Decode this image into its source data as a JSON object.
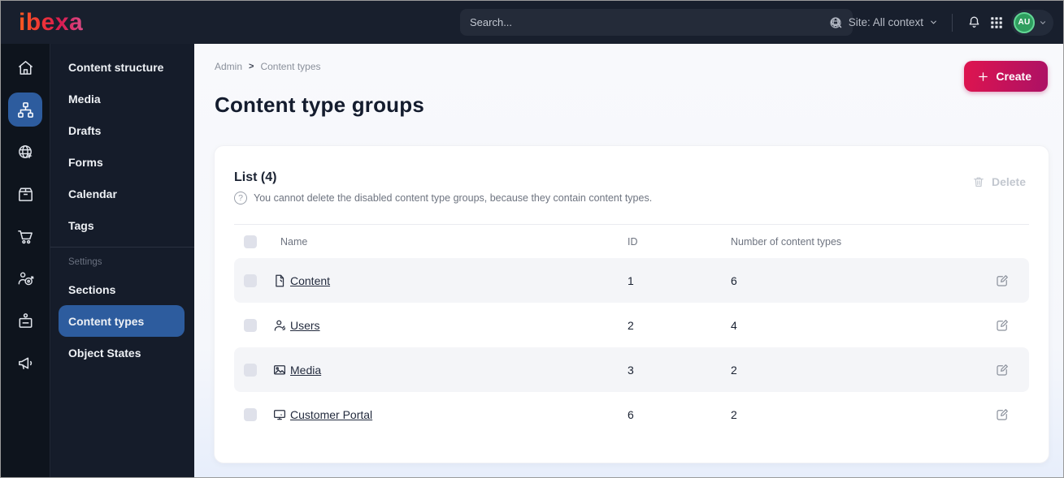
{
  "topbar": {
    "logo_text": "ibexa",
    "search_placeholder": "Search...",
    "site_context_label": "Site: All context",
    "avatar_initials": "AU"
  },
  "sidebar": {
    "rail_icons": [
      "home",
      "content-structure",
      "site",
      "product-catalog",
      "commerce",
      "customer",
      "corporate",
      "marketing"
    ],
    "items_top": [
      "Content structure",
      "Media",
      "Drafts",
      "Forms",
      "Calendar",
      "Tags"
    ],
    "section_label": "Settings",
    "items_settings": [
      "Sections",
      "Content types",
      "Object States"
    ],
    "active_item": "Content types"
  },
  "breadcrumb": {
    "items": [
      "Admin",
      "Content types"
    ],
    "separator": ">"
  },
  "page": {
    "title": "Content type groups",
    "create_button_label": "Create"
  },
  "list_panel": {
    "title": "List (4)",
    "info_text": "You cannot delete the disabled content type groups, because they contain content types.",
    "delete_button_label": "Delete",
    "table": {
      "columns": [
        "Name",
        "ID",
        "Number of content types"
      ],
      "rows": [
        {
          "icon": "file-icon",
          "name": "Content",
          "id": "1",
          "content_types_count": "6"
        },
        {
          "icon": "user-icon",
          "name": "Users",
          "id": "2",
          "content_types_count": "4"
        },
        {
          "icon": "image-icon",
          "name": "Media",
          "id": "3",
          "content_types_count": "2"
        },
        {
          "icon": "monitor-icon",
          "name": "Customer Portal",
          "id": "6",
          "content_types_count": "2"
        }
      ]
    }
  },
  "colors": {
    "topbar_bg": "#181f2d",
    "rail_bg": "#0e141d",
    "menu_bg": "#151c2a",
    "active_blue": "#2d5c9e",
    "create_gradient_start": "#dc1450",
    "create_gradient_end": "#ae1164",
    "avatar_green": "#2f9e5f",
    "row_stripe": "#f4f5f8"
  }
}
